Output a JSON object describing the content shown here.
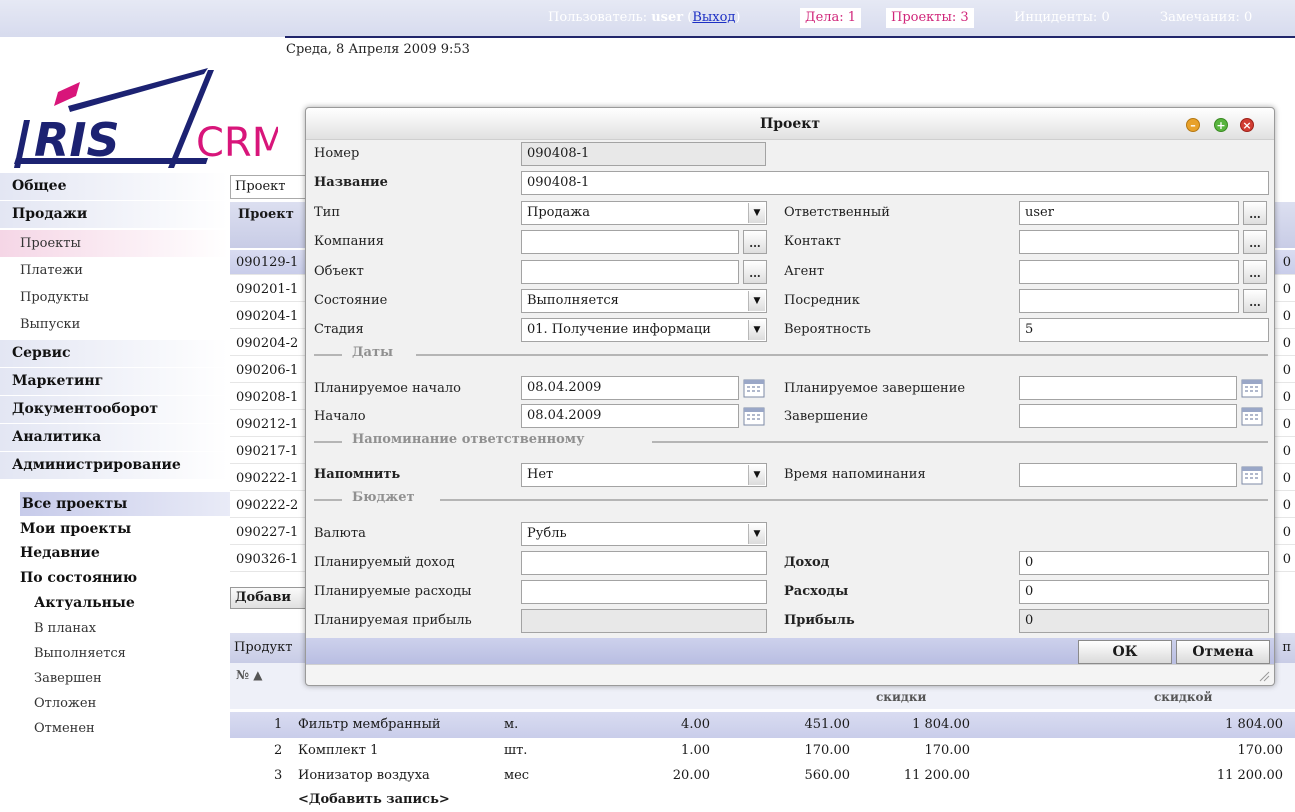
{
  "topbar": {
    "user_label": "Пользователь:",
    "user_name": "user",
    "logout_link": "Выход",
    "tasks": "Дела: 1",
    "projects": "Проекты: 3",
    "incidents": "Инциденты: 0",
    "remarks": "Замечания: 0",
    "date": "Среда, 8 Апреля 2009 9:53"
  },
  "logo": {
    "text_main": "RIS",
    "text_crm": "CRM",
    "colors": {
      "navy": "#1c2272",
      "pink": "#d8157a"
    }
  },
  "nav": {
    "groups": [
      "Общее",
      "Продажи",
      "Сервис",
      "Маркетинг",
      "Документооборот",
      "Аналитика",
      "Администрирование"
    ],
    "sales_items": [
      "Проекты",
      "Платежи",
      "Продукты",
      "Выпуски"
    ]
  },
  "filters": {
    "items": [
      "Все проекты",
      "Мои проекты",
      "Недавние",
      "По состоянию"
    ],
    "states": [
      "Актуальные",
      "В планах",
      "Выполняется",
      "Завершен",
      "Отложен",
      "Отменен"
    ]
  },
  "grid": {
    "toolbar_label": "Проект",
    "header_label": "Проект",
    "rows": [
      "090129-1",
      "090201-1",
      "090204-1",
      "090204-2",
      "090206-1",
      "090208-1",
      "090212-1",
      "090217-1",
      "090222-1",
      "090222-2",
      "090227-1",
      "090326-1"
    ],
    "add_button": "Добави"
  },
  "products": {
    "header_label": "Продукт",
    "header_right": "п",
    "col_no": "№",
    "col_discount": "скидки",
    "col_with_discount": "скидкой",
    "rows": [
      {
        "no": "1",
        "name": "Фильтр мембранный",
        "unit": "м.",
        "qty": "4.00",
        "price": "451.00",
        "sum": "1 804.00",
        "total": "1 804.00"
      },
      {
        "no": "2",
        "name": "Комплект 1",
        "unit": "шт.",
        "qty": "1.00",
        "price": "170.00",
        "sum": "170.00",
        "total": "170.00"
      },
      {
        "no": "3",
        "name": "Ионизатор воздуха",
        "unit": "мес",
        "qty": "20.00",
        "price": "560.00",
        "sum": "11 200.00",
        "total": "11 200.00"
      }
    ],
    "add_record": "<Добавить запись>"
  },
  "dialog": {
    "title": "Проект",
    "fields": {
      "number_label": "Номер",
      "number_value": "090408-1",
      "name_label": "Название",
      "name_value": "090408-1",
      "type_label": "Тип",
      "type_value": "Продажа",
      "responsible_label": "Ответственный",
      "responsible_value": "user",
      "company_label": "Компания",
      "company_value": "",
      "contact_label": "Контакт",
      "contact_value": "",
      "object_label": "Объект",
      "object_value": "",
      "agent_label": "Агент",
      "agent_value": "",
      "state_label": "Состояние",
      "state_value": "Выполняется",
      "mediator_label": "Посредник",
      "mediator_value": "",
      "stage_label": "Стадия",
      "stage_value": "01. Получение информаци",
      "probability_label": "Вероятность",
      "probability_value": "5",
      "planned_start_label": "Планируемое начало",
      "planned_start_value": "08.04.2009",
      "planned_end_label": "Планируемое завершение",
      "planned_end_value": "",
      "start_label": "Начало",
      "start_value": "08.04.2009",
      "end_label": "Завершение",
      "end_value": "",
      "remind_label": "Напомнить",
      "remind_value": "Нет",
      "remind_time_label": "Время напоминания",
      "remind_time_value": "",
      "currency_label": "Валюта",
      "currency_value": "Рубль",
      "planned_income_label": "Планируемый доход",
      "planned_income_value": "",
      "income_label": "Доход",
      "income_value": "0",
      "planned_expenses_label": "Планируемые расходы",
      "planned_expenses_value": "",
      "expenses_label": "Расходы",
      "expenses_value": "0",
      "planned_profit_label": "Планируемая прибыль",
      "planned_profit_value": "",
      "profit_label": "Прибыль",
      "profit_value": "0"
    },
    "sections": {
      "dates": "Даты",
      "reminder": "Напоминание ответственному",
      "budget": "Бюджет"
    },
    "buttons": {
      "ok": "ОК",
      "cancel": "Отмена"
    },
    "picker_label": "..."
  }
}
